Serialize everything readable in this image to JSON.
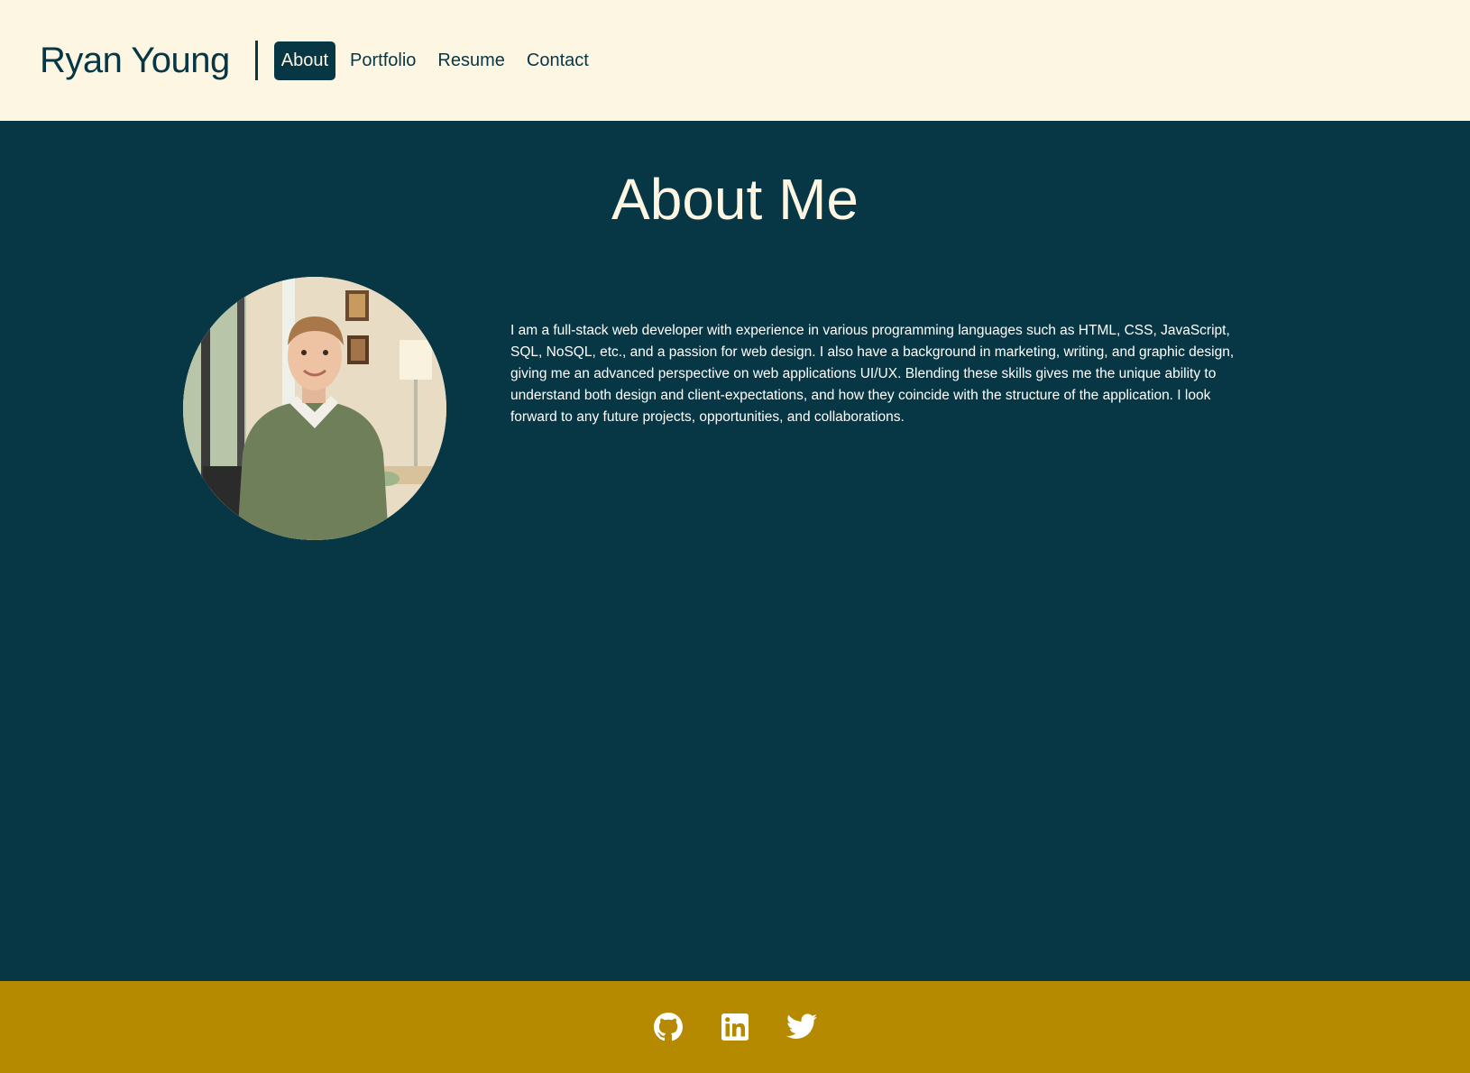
{
  "header": {
    "brand": "Ryan Young",
    "nav": [
      {
        "label": "About",
        "active": true
      },
      {
        "label": "Portfolio",
        "active": false
      },
      {
        "label": "Resume",
        "active": false
      },
      {
        "label": "Contact",
        "active": false
      }
    ]
  },
  "main": {
    "title": "About Me",
    "bio": "I am a full-stack web developer with experience in various programming languages such as HTML, CSS, JavaScript, SQL, NoSQL, etc., and a passion for web design. I also have a background in marketing, writing, and graphic design, giving me an advanced perspective on web applications UI/UX. Blending these skills gives me the unique ability to understand both design and client-expectations, and how they coincide with the structure of the application. I look forward to any future projects, opportunities, and collaborations."
  },
  "footer": {
    "social": [
      {
        "icon": "github-icon"
      },
      {
        "icon": "linkedin-icon"
      },
      {
        "icon": "twitter-icon"
      }
    ]
  },
  "colors": {
    "cream": "#fdf6e3",
    "dark_teal": "#073745",
    "gold": "#b58900"
  }
}
